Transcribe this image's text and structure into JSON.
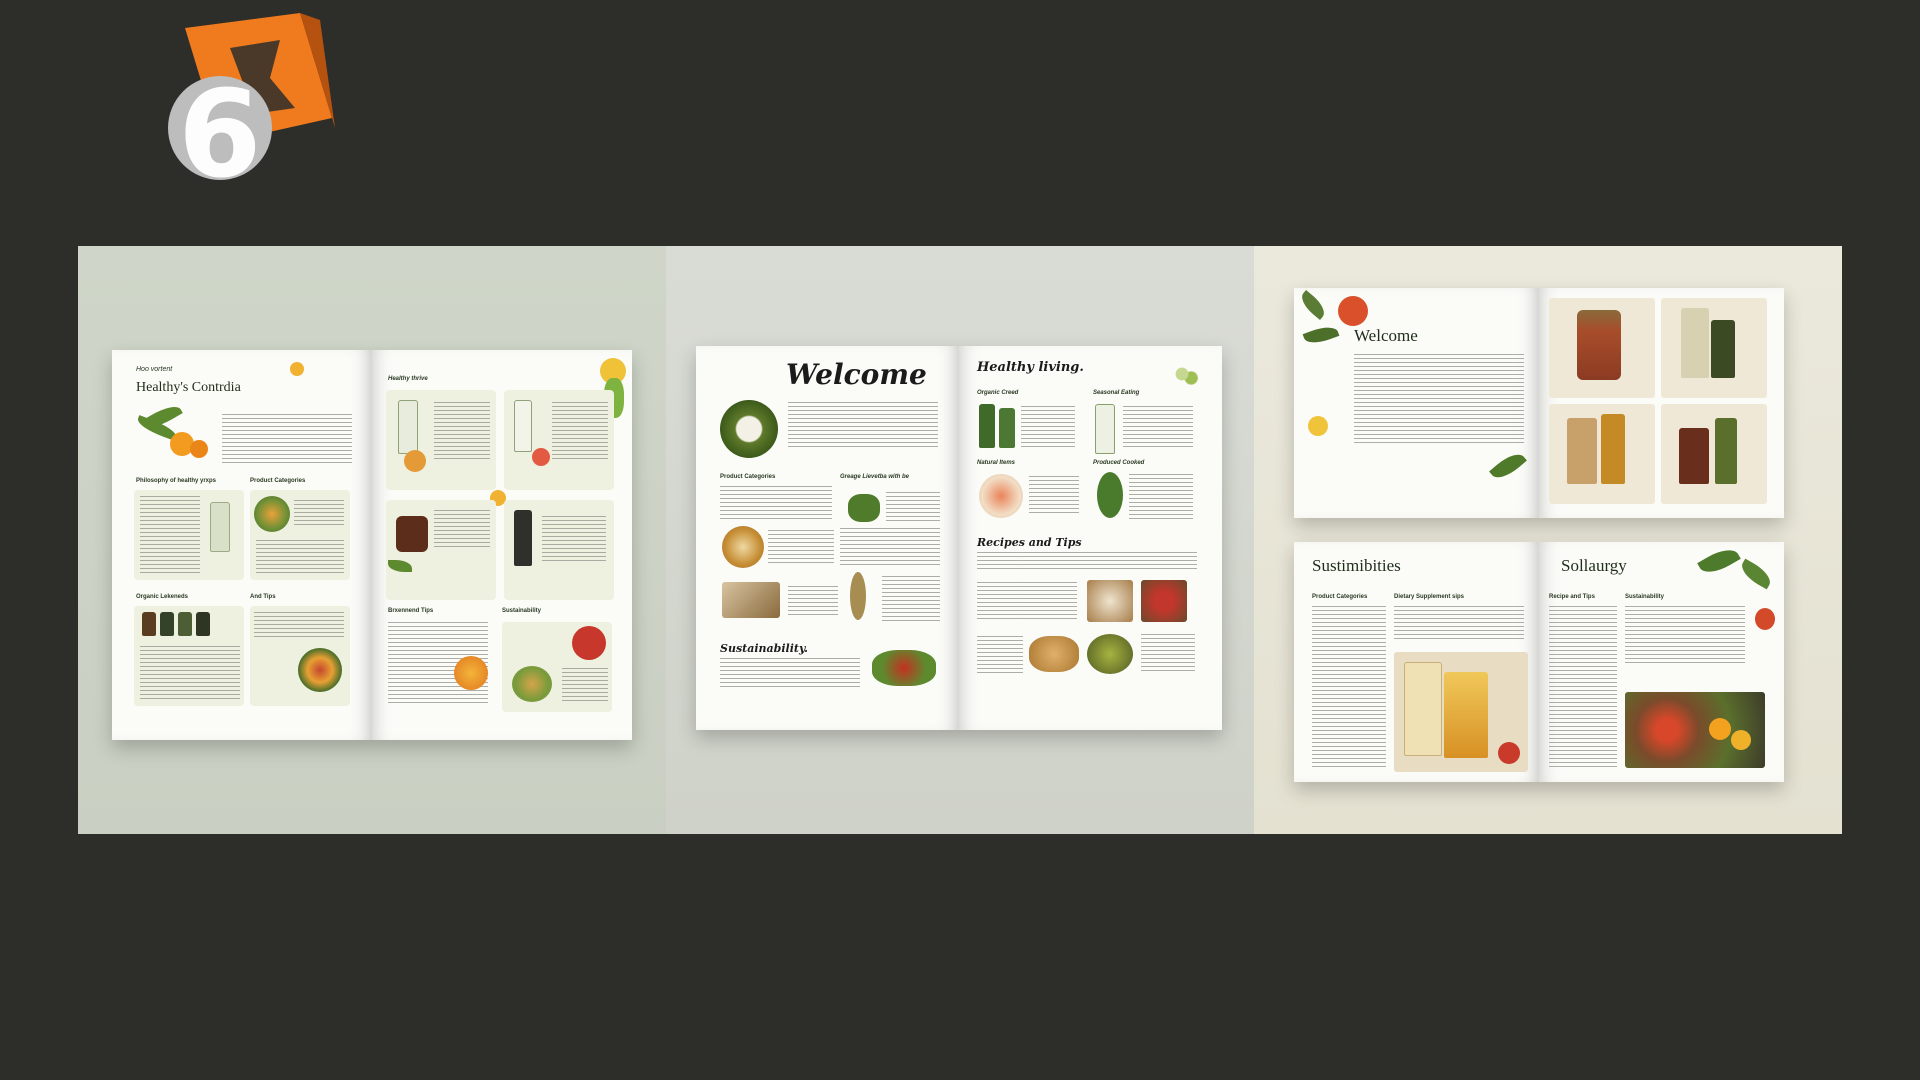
{
  "logo": {
    "digit": "6",
    "accent": "#f07a1e"
  },
  "panel1": {
    "kicker": "Hoo vortent",
    "title": "Healthy's Contrdia",
    "right_title": "Healthy thrive",
    "headings": {
      "philosophy": "Philosophy of healthy yrxps",
      "categories": "Product Categories",
      "organic": "Organic Lekeneds",
      "tips_left": "And Tips",
      "tips_right": "Brxennend Tips",
      "sustain": "Sustainability"
    }
  },
  "panel2": {
    "title": "Welcome",
    "right_title": "Healthy living.",
    "headings": {
      "categories": "Product Categories",
      "green": "Greage Lievetba with be",
      "recipes": "Recipes and Tips",
      "sustain": "Sustainability.",
      "organic": "Organic Creed",
      "seasonal": "Seasonal Eating",
      "natural": "Natural Items",
      "produce": "Produced Cooked"
    }
  },
  "panel3": {
    "welcome": "Welcome",
    "sustain": "Sustimibities",
    "right_title": "Sollaurgy",
    "headings": {
      "categories": "Product Categories",
      "dietary": "Dietary Supplement sips",
      "recipe": "Recipe and Tips",
      "sustain_small": "Sustainability"
    }
  }
}
